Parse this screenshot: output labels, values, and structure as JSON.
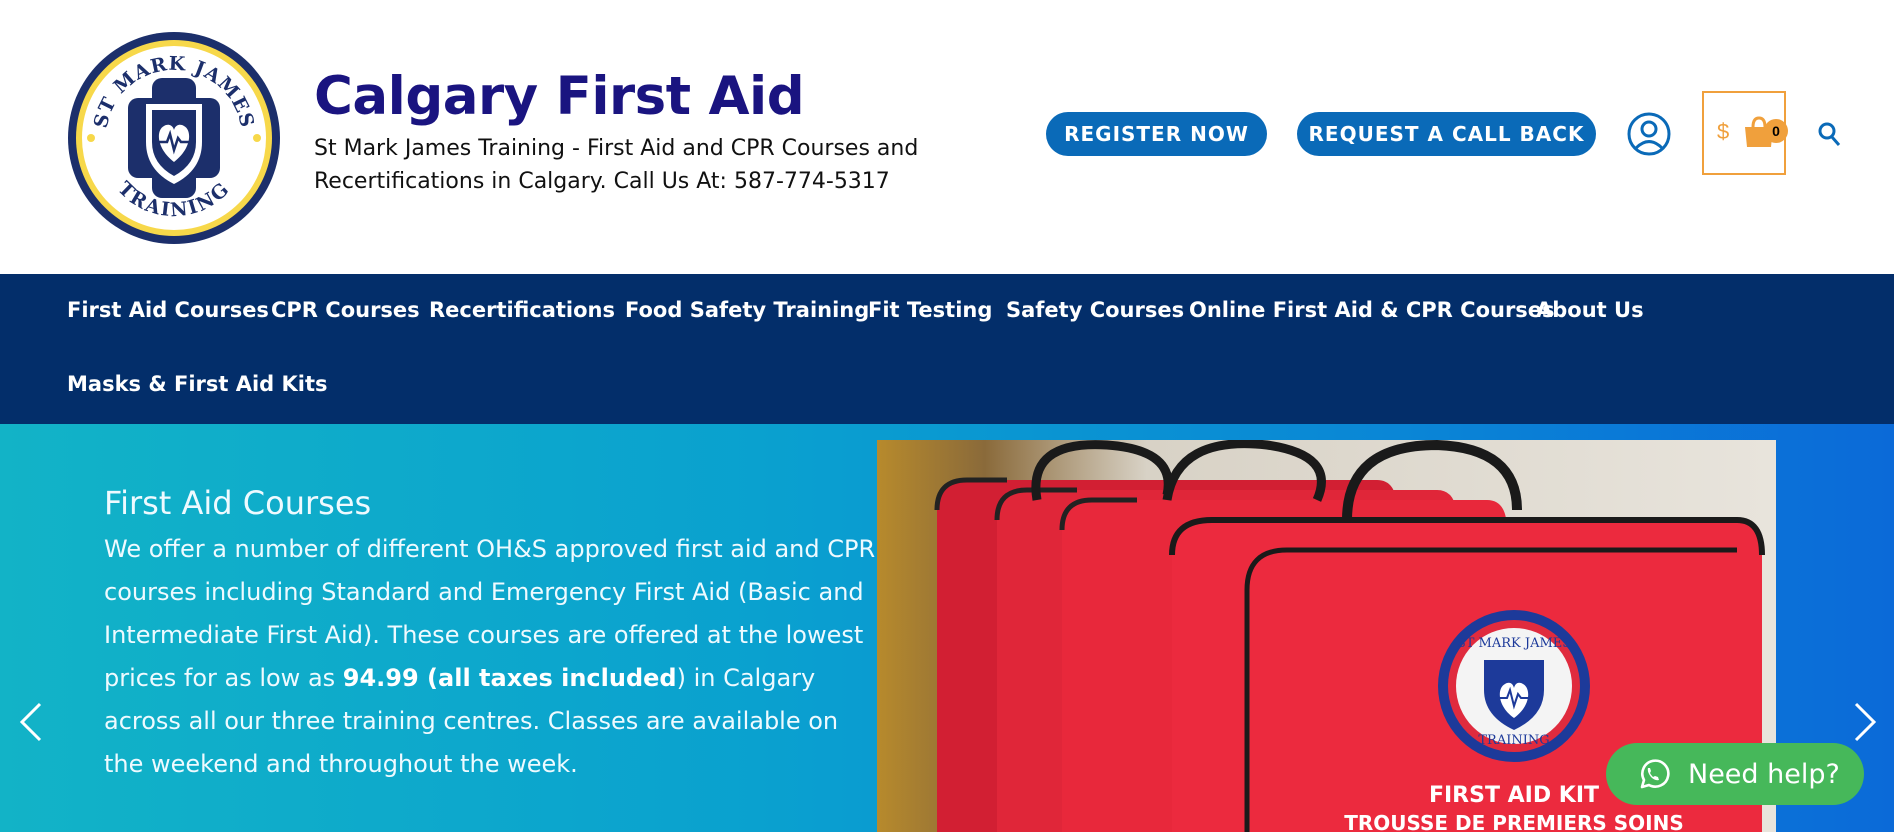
{
  "header": {
    "logo_text": {
      "top": "ST MARK JAMES",
      "bottom": "TRAINING"
    },
    "site_title": "Calgary First Aid",
    "tagline": "St Mark James Training - First Aid and CPR Courses and Recertifications in Calgary. Call Us At: 587-774-5317",
    "register_label": "REGISTER NOW",
    "callback_label": "REQUEST A CALL BACK",
    "cart": {
      "price": "$",
      "count": "0"
    },
    "icons": {
      "user": "user-circle-icon",
      "cart": "shopping-bag-icon",
      "search": "search-icon"
    }
  },
  "nav": {
    "items": [
      {
        "label": "First Aid Courses"
      },
      {
        "label": "CPR Courses"
      },
      {
        "label": "Recertifications"
      },
      {
        "label": "Food Safety Training"
      },
      {
        "label": "Fit Testing"
      },
      {
        "label": "Safety Courses"
      },
      {
        "label": "Online First Aid & CPR Courses"
      },
      {
        "label": "About Us"
      },
      {
        "label": "Masks & First Aid Kits"
      }
    ]
  },
  "hero": {
    "title": "First Aid Courses",
    "text_part1": "We offer a number of different OH&S approved first aid and CPR courses including Standard and Emergency First Aid (Basic and Intermediate First Aid). These courses are offered at the lowest prices for as low as ",
    "text_bold": "94.99 (all taxes included",
    "text_part2": ") in Calgary across all our three training centres. Classes are available on the weekend and throughout the week.",
    "image": {
      "kit_label": "FIRST AID KIT",
      "kit_label_fr": "TROUSSE DE PREMIERS SOINS",
      "badge_text": {
        "top": "ST MARK JAMES",
        "bottom": "TRAINING"
      }
    },
    "prev_icon": "chevron-left-icon",
    "next_icon": "chevron-right-icon"
  },
  "help": {
    "label": "Need help?",
    "icon": "whatsapp-icon"
  },
  "colors": {
    "brand_title": "#1a1480",
    "button_blue": "#0a6ab8",
    "nav_bg": "#032e6a",
    "cart_accent": "#f0a03c",
    "help_green": "#46b85a",
    "kit_red": "#e8263a"
  }
}
